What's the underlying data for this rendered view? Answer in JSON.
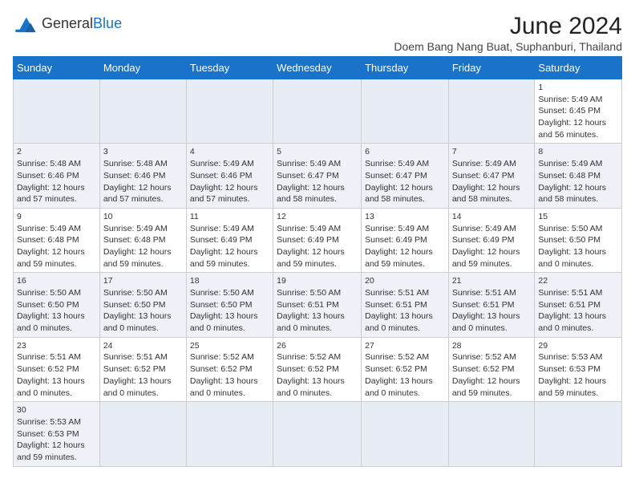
{
  "logo": {
    "general": "General",
    "blue": "Blue"
  },
  "title": "June 2024",
  "subtitle": "Doem Bang Nang Buat, Suphanburi, Thailand",
  "days_of_week": [
    "Sunday",
    "Monday",
    "Tuesday",
    "Wednesday",
    "Thursday",
    "Friday",
    "Saturday"
  ],
  "weeks": [
    [
      {
        "day": null,
        "info": null
      },
      {
        "day": null,
        "info": null
      },
      {
        "day": null,
        "info": null
      },
      {
        "day": null,
        "info": null
      },
      {
        "day": null,
        "info": null
      },
      {
        "day": null,
        "info": null
      },
      {
        "day": "1",
        "info": "Sunrise: 5:49 AM\nSunset: 6:45 PM\nDaylight: 12 hours\nand 56 minutes."
      }
    ],
    [
      {
        "day": "2",
        "info": "Sunrise: 5:48 AM\nSunset: 6:46 PM\nDaylight: 12 hours\nand 57 minutes."
      },
      {
        "day": "3",
        "info": "Sunrise: 5:48 AM\nSunset: 6:46 PM\nDaylight: 12 hours\nand 57 minutes."
      },
      {
        "day": "4",
        "info": "Sunrise: 5:49 AM\nSunset: 6:46 PM\nDaylight: 12 hours\nand 57 minutes."
      },
      {
        "day": "5",
        "info": "Sunrise: 5:49 AM\nSunset: 6:47 PM\nDaylight: 12 hours\nand 58 minutes."
      },
      {
        "day": "6",
        "info": "Sunrise: 5:49 AM\nSunset: 6:47 PM\nDaylight: 12 hours\nand 58 minutes."
      },
      {
        "day": "7",
        "info": "Sunrise: 5:49 AM\nSunset: 6:47 PM\nDaylight: 12 hours\nand 58 minutes."
      },
      {
        "day": "8",
        "info": "Sunrise: 5:49 AM\nSunset: 6:48 PM\nDaylight: 12 hours\nand 58 minutes."
      }
    ],
    [
      {
        "day": "9",
        "info": "Sunrise: 5:49 AM\nSunset: 6:48 PM\nDaylight: 12 hours\nand 59 minutes."
      },
      {
        "day": "10",
        "info": "Sunrise: 5:49 AM\nSunset: 6:48 PM\nDaylight: 12 hours\nand 59 minutes."
      },
      {
        "day": "11",
        "info": "Sunrise: 5:49 AM\nSunset: 6:49 PM\nDaylight: 12 hours\nand 59 minutes."
      },
      {
        "day": "12",
        "info": "Sunrise: 5:49 AM\nSunset: 6:49 PM\nDaylight: 12 hours\nand 59 minutes."
      },
      {
        "day": "13",
        "info": "Sunrise: 5:49 AM\nSunset: 6:49 PM\nDaylight: 12 hours\nand 59 minutes."
      },
      {
        "day": "14",
        "info": "Sunrise: 5:49 AM\nSunset: 6:49 PM\nDaylight: 12 hours\nand 59 minutes."
      },
      {
        "day": "15",
        "info": "Sunrise: 5:50 AM\nSunset: 6:50 PM\nDaylight: 13 hours\nand 0 minutes."
      }
    ],
    [
      {
        "day": "16",
        "info": "Sunrise: 5:50 AM\nSunset: 6:50 PM\nDaylight: 13 hours\nand 0 minutes."
      },
      {
        "day": "17",
        "info": "Sunrise: 5:50 AM\nSunset: 6:50 PM\nDaylight: 13 hours\nand 0 minutes."
      },
      {
        "day": "18",
        "info": "Sunrise: 5:50 AM\nSunset: 6:50 PM\nDaylight: 13 hours\nand 0 minutes."
      },
      {
        "day": "19",
        "info": "Sunrise: 5:50 AM\nSunset: 6:51 PM\nDaylight: 13 hours\nand 0 minutes."
      },
      {
        "day": "20",
        "info": "Sunrise: 5:51 AM\nSunset: 6:51 PM\nDaylight: 13 hours\nand 0 minutes."
      },
      {
        "day": "21",
        "info": "Sunrise: 5:51 AM\nSunset: 6:51 PM\nDaylight: 13 hours\nand 0 minutes."
      },
      {
        "day": "22",
        "info": "Sunrise: 5:51 AM\nSunset: 6:51 PM\nDaylight: 13 hours\nand 0 minutes."
      }
    ],
    [
      {
        "day": "23",
        "info": "Sunrise: 5:51 AM\nSunset: 6:52 PM\nDaylight: 13 hours\nand 0 minutes."
      },
      {
        "day": "24",
        "info": "Sunrise: 5:51 AM\nSunset: 6:52 PM\nDaylight: 13 hours\nand 0 minutes."
      },
      {
        "day": "25",
        "info": "Sunrise: 5:52 AM\nSunset: 6:52 PM\nDaylight: 13 hours\nand 0 minutes."
      },
      {
        "day": "26",
        "info": "Sunrise: 5:52 AM\nSunset: 6:52 PM\nDaylight: 13 hours\nand 0 minutes."
      },
      {
        "day": "27",
        "info": "Sunrise: 5:52 AM\nSunset: 6:52 PM\nDaylight: 13 hours\nand 0 minutes."
      },
      {
        "day": "28",
        "info": "Sunrise: 5:52 AM\nSunset: 6:52 PM\nDaylight: 12 hours\nand 59 minutes."
      },
      {
        "day": "29",
        "info": "Sunrise: 5:53 AM\nSunset: 6:53 PM\nDaylight: 12 hours\nand 59 minutes."
      }
    ],
    [
      {
        "day": "30",
        "info": "Sunrise: 5:53 AM\nSunset: 6:53 PM\nDaylight: 12 hours\nand 59 minutes."
      },
      {
        "day": null,
        "info": null
      },
      {
        "day": null,
        "info": null
      },
      {
        "day": null,
        "info": null
      },
      {
        "day": null,
        "info": null
      },
      {
        "day": null,
        "info": null
      },
      {
        "day": null,
        "info": null
      }
    ]
  ],
  "colors": {
    "header_bg": "#1a73c8",
    "accent": "#1a73c8"
  }
}
